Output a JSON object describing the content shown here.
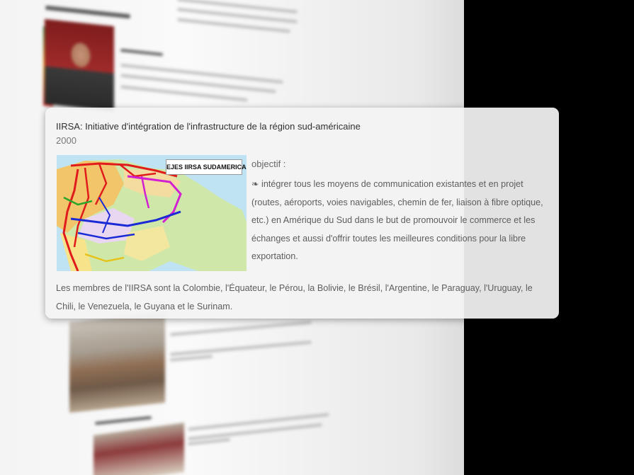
{
  "tooltip": {
    "title": "IIRSA: Initiative d'intégration de l'infrastructure de la région sud-américaine",
    "year": "2000",
    "map_label": "EJES IIRSA SUDAMERICA",
    "objective_label": "objectif :",
    "objective_text": "❧ intégrer tous les moyens de communication existantes et en projet (routes, aéroports, voies navigables, chemin de fer, liaison à fibre optique, etc.) en Amérique du Sud dans le but de promouvoir le commerce et les échanges et aussi d'offrir toutes les meilleures conditions pour la libre exportation.",
    "members_text": "Les membres de l'IIRSA sont la Colombie, l'Équateur, le Pérou, la Bolivie, le Brésil, l'Argentine, le Paraguay, l'Uruguay, le Chili, le Venezuela, le Guyana et le Surinam."
  },
  "colors": {
    "card_background": "#f3f3f3",
    "page_background": "#000000",
    "route_red": "#e01b1b",
    "route_blue": "#1a2bd6",
    "route_magenta": "#d21fd2"
  }
}
